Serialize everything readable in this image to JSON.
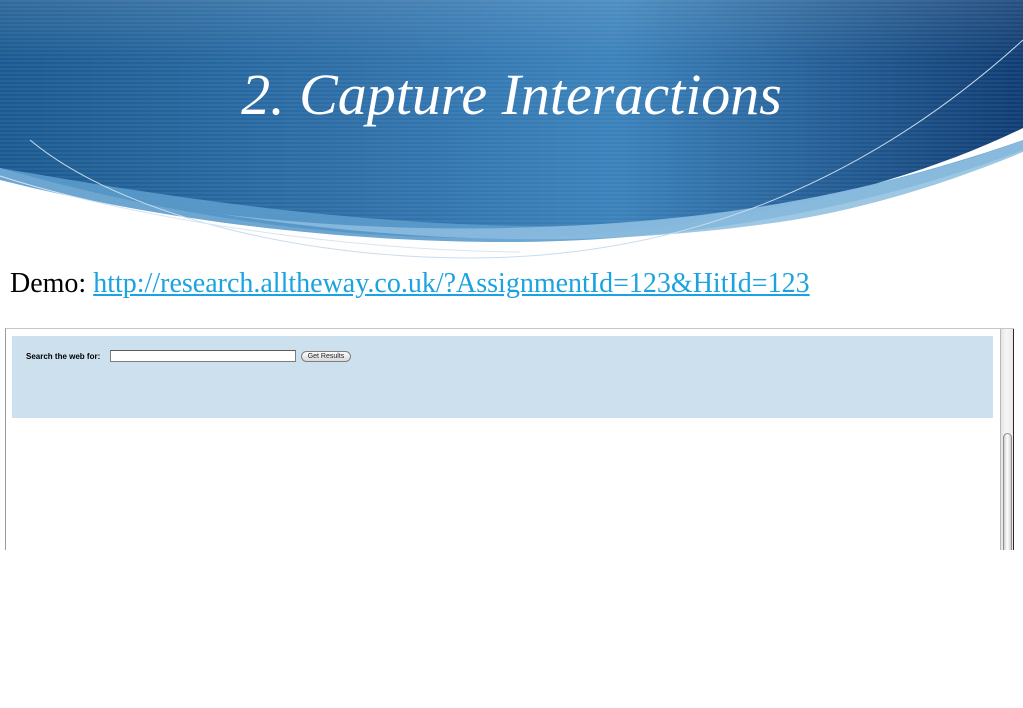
{
  "slide": {
    "title": "2. Capture Interactions",
    "demo_label": "Demo:",
    "demo_url": "http://research.alltheway.co.uk/?AssignmentId=123&HitId=123"
  },
  "embedded_page": {
    "search_label": "Search the web for:",
    "search_value": "",
    "search_button_label": "Get Results",
    "panel_color": "#cce0ed"
  },
  "theme": {
    "header_dark_blue": "#123f74",
    "header_mid_blue": "#3b7fb6",
    "link_color": "#1aa3e0"
  }
}
